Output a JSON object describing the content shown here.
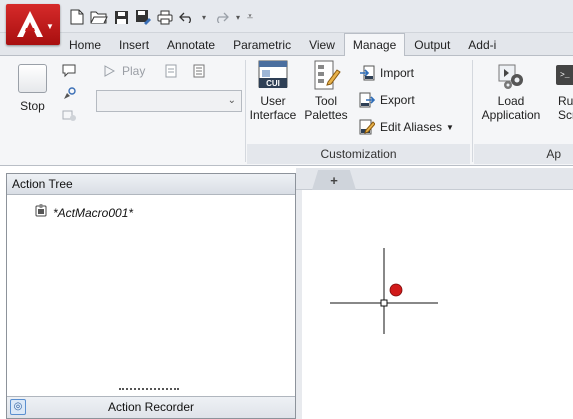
{
  "quick_access": {
    "icons": [
      "new-file-icon",
      "open-folder-icon",
      "save-icon",
      "save-as-icon",
      "print-icon",
      "undo-icon",
      "redo-icon",
      "customize-icon"
    ]
  },
  "tabs": [
    "Home",
    "Insert",
    "Annotate",
    "Parametric",
    "View",
    "Manage",
    "Output",
    "Add-i"
  ],
  "active_tab": "Manage",
  "ribbon": {
    "action_recorder": {
      "stop_label": "Stop",
      "play_label": "Play",
      "macro_combo_value": ""
    },
    "customization": {
      "user_interface_label": "User\nInterface",
      "user_interface_line1": "User",
      "user_interface_line2": "Interface",
      "cui_badge": "CUI",
      "tool_palettes_line1": "Tool",
      "tool_palettes_line2": "Palettes",
      "import_label": "Import",
      "export_label": "Export",
      "edit_aliases_label": "Edit Aliases",
      "panel_title": "Customization"
    },
    "applications": {
      "load_line1": "Load",
      "load_line2": "Application",
      "run_line1": "Ru",
      "run_line2": "Scr",
      "panel_title": "Ap"
    }
  },
  "palette": {
    "title": "Action Tree",
    "macro_name": "*ActMacro001*",
    "footer_label": "Action Recorder"
  },
  "doc_tabs": {
    "new_tab_label": "+"
  },
  "colors": {
    "app_button": "#c41a1a",
    "point_marker": "#d11a1a"
  }
}
